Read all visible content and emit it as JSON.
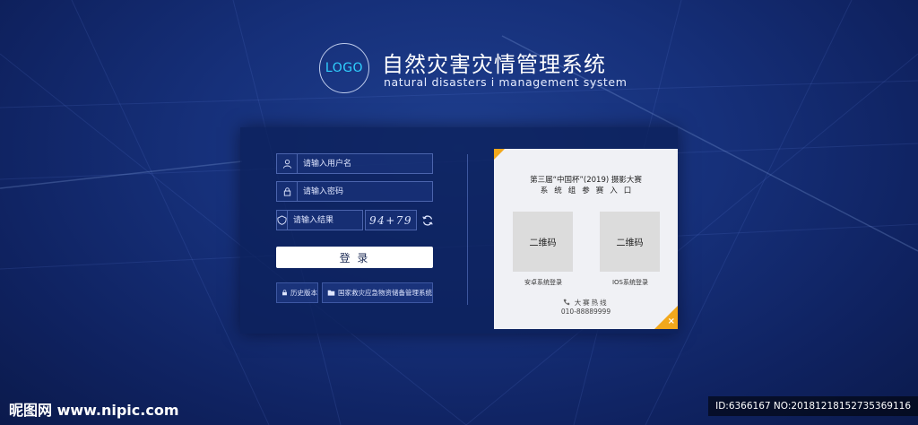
{
  "header": {
    "logo_text": "LOGO",
    "title_cn": "自然灾害灾情管理系统",
    "title_en": "natural disasters i management system"
  },
  "login": {
    "username_placeholder": "请输入用户名",
    "password_placeholder": "请输入密码",
    "captcha_placeholder": "请输入结果",
    "captcha_text": "94+79",
    "login_label": "登 录",
    "history_label": "历史版本",
    "national_system_label": "国家救灾应急物资储备管理系统"
  },
  "card": {
    "title_line1": "第三届“中国杯”(2019) 摄影大赛",
    "title_line2": "系统组参赛入口",
    "qr_android_text": "二维码",
    "qr_ios_text": "二维码",
    "android_label": "安卓系统登录",
    "ios_label": "IOS系统登录",
    "hotline_label": "大赛热线",
    "hotline_number": "010-88889999",
    "close_symbol": "×"
  },
  "watermark": {
    "left_text": "昵图网 www.nipic.com",
    "right_text": "ID:6366167 NO:20181218152735369116"
  },
  "colors": {
    "accent_orange": "#f2a81c",
    "logo_cyan": "#2fd0ff",
    "background_blue": "#16307a"
  }
}
